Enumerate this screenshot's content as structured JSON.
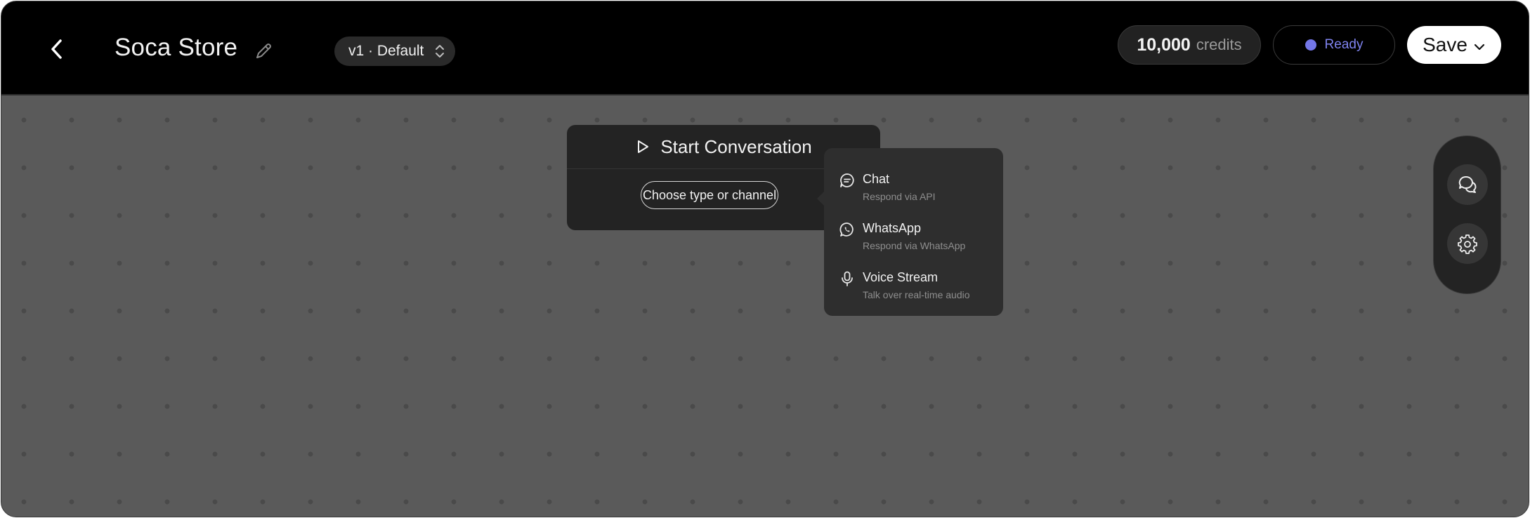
{
  "header": {
    "back_icon": "chevron-left-icon",
    "title": "Soca Store",
    "edit_icon": "pencil-icon",
    "version": {
      "label": "v1 · Default",
      "icon": "chevron-up-down-icon"
    },
    "credits": {
      "amount": "10,000",
      "unit": "credits"
    },
    "status": {
      "label": "Ready",
      "dot_color": "#7477e8"
    },
    "save": {
      "label": "Save",
      "icon": "chevron-down-icon"
    }
  },
  "start_node": {
    "icon": "play-icon",
    "title": "Start Conversation",
    "choose_label": "Choose type or channel"
  },
  "channel_menu": {
    "items": [
      {
        "title": "Chat",
        "subtitle": "Respond via API",
        "icon": "chat-bubble-icon"
      },
      {
        "title": "WhatsApp",
        "subtitle": "Respond via WhatsApp",
        "icon": "whatsapp-icon"
      },
      {
        "title": "Voice Stream",
        "subtitle": "Talk over real-time audio",
        "icon": "microphone-icon"
      }
    ]
  },
  "toolbar": {
    "chat_icon": "chat-bubbles-icon",
    "settings_icon": "gear-icon"
  },
  "colors": {
    "canvas": "#5a5a5a",
    "topbar": "#000000",
    "accent": "#7477e8"
  }
}
